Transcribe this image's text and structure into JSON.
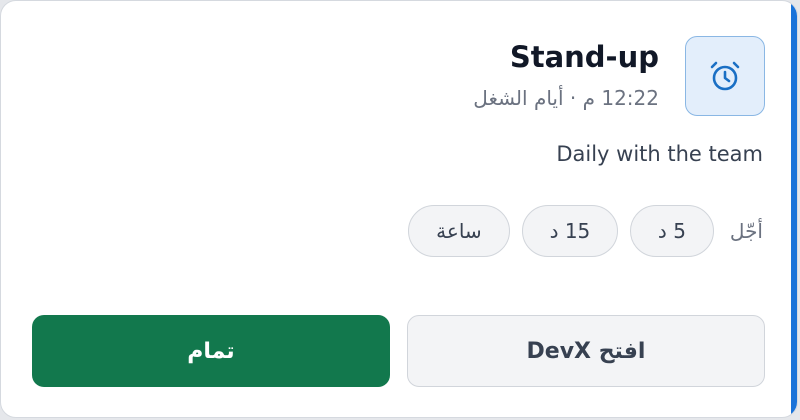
{
  "notification": {
    "title": "Stand-up",
    "subtitle": "12:22 م · أيام الشغل",
    "description": "Daily with the team",
    "icon": "alarm-clock-icon",
    "accent_color": "#1a73d9"
  },
  "snooze": {
    "label": "أجّل",
    "options": [
      "5 د",
      "15 د",
      "ساعة"
    ]
  },
  "actions": {
    "open_label": "افتح DevX",
    "done_label": "تمام",
    "done_color": "#12784d"
  }
}
